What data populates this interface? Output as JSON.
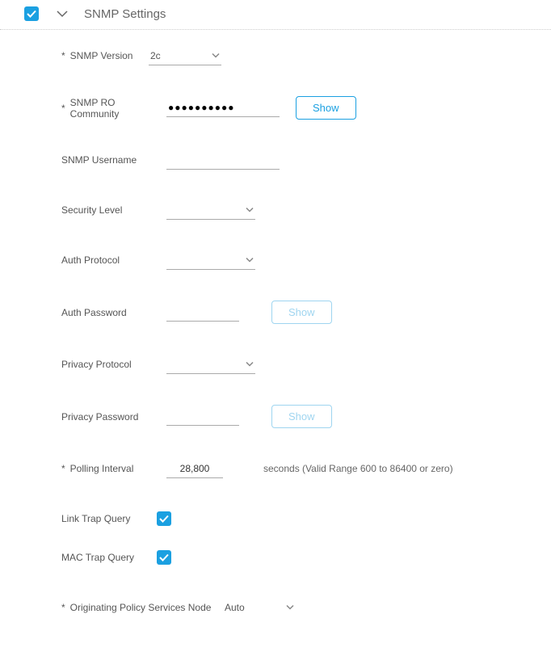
{
  "section": {
    "title": "SNMP Settings"
  },
  "labels": {
    "snmp_version": "SNMP Version",
    "snmp_ro_community": "SNMP RO Community",
    "snmp_username": "SNMP Username",
    "security_level": "Security Level",
    "auth_protocol": "Auth Protocol",
    "auth_password": "Auth Password",
    "privacy_protocol": "Privacy Protocol",
    "privacy_password": "Privacy Password",
    "polling_interval": "Polling Interval",
    "link_trap_query": "Link Trap Query",
    "mac_trap_query": "MAC Trap Query",
    "orig_policy_node": "Originating Policy Services Node"
  },
  "values": {
    "snmp_version": "2c",
    "snmp_ro_community_masked": "●●●●●●●●●●",
    "snmp_username": "",
    "security_level": "",
    "auth_protocol": "",
    "auth_password": "",
    "privacy_protocol": "",
    "privacy_password": "",
    "polling_interval": "28,800",
    "orig_policy_node": "Auto"
  },
  "buttons": {
    "show": "Show"
  },
  "helper": {
    "polling": "seconds (Valid Range 600 to 86400 or zero)"
  },
  "required_marker": "*"
}
